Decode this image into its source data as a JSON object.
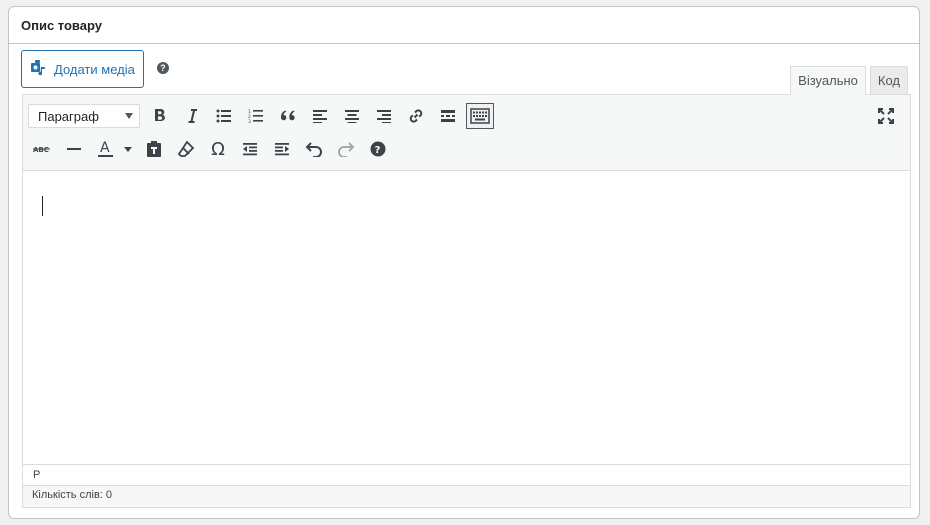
{
  "panel": {
    "title": "Опис товару"
  },
  "media": {
    "add_label": "Додати медіа",
    "help_glyph": "?"
  },
  "tabs": [
    {
      "label": "Візуально",
      "active": true
    },
    {
      "label": "Код",
      "active": false
    }
  ],
  "toolbar": {
    "format_select": "Параграф",
    "row1_icons": [
      "bold-icon",
      "italic-icon",
      "bulleted-list-icon",
      "numbered-list-icon",
      "blockquote-icon",
      "align-left-icon",
      "align-center-icon",
      "align-right-icon",
      "insert-link-icon",
      "read-more-icon",
      "toolbar-toggle-icon"
    ],
    "row2_icons": [
      "strikethrough-icon",
      "horizontal-line-icon",
      "text-color-icon",
      "paste-as-text-icon",
      "clear-formatting-icon",
      "special-character-icon",
      "outdent-icon",
      "indent-icon",
      "undo-icon",
      "redo-icon",
      "keyboard-shortcuts-icon"
    ],
    "fullscreen_icon": "fullscreen-icon"
  },
  "editor": {
    "path": "P",
    "word_count": "Кількість слів: 0"
  },
  "colors": {
    "accent": "#2271b1",
    "border": "#c3c4c7",
    "toolbar_bg": "#f6f7f7"
  }
}
